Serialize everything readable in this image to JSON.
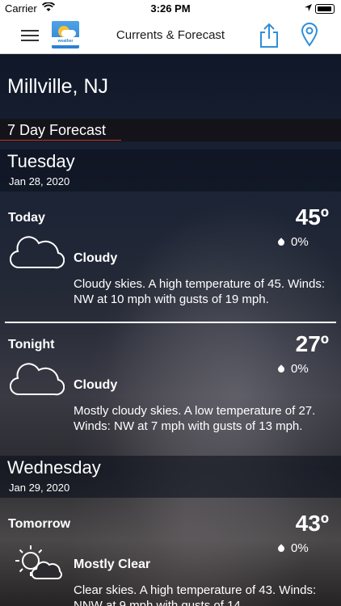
{
  "status": {
    "carrier": "Carrier",
    "time": "3:26 PM"
  },
  "nav": {
    "title": "Currents & Forecast",
    "logo_text": "weather"
  },
  "location": "Millville, NJ",
  "section_title": "7 Day Forecast",
  "days": [
    {
      "name": "Tuesday",
      "date": "Jan 28, 2020",
      "periods": [
        {
          "name": "Today",
          "temp": "45º",
          "precip": "0%",
          "condition": "Cloudy",
          "icon": "cloud-icon",
          "description": "Cloudy skies.  A high temperature of 45.  Winds: NW at 10 mph with gusts of 19 mph."
        },
        {
          "name": "Tonight",
          "temp": "27º",
          "precip": "0%",
          "condition": "Cloudy",
          "icon": "cloud-icon",
          "description": "Mostly cloudy skies.  A low temperature of 27.  Winds: NW at 7 mph with gusts of 13 mph."
        }
      ]
    },
    {
      "name": "Wednesday",
      "date": "Jan 29, 2020",
      "periods": [
        {
          "name": "Tomorrow",
          "temp": "43º",
          "precip": "0%",
          "condition": "Mostly Clear",
          "icon": "sun-cloud-icon",
          "description": "Clear skies.  A high temperature of 43.  Winds: NNW at 9 mph with gusts of 14"
        }
      ]
    }
  ]
}
